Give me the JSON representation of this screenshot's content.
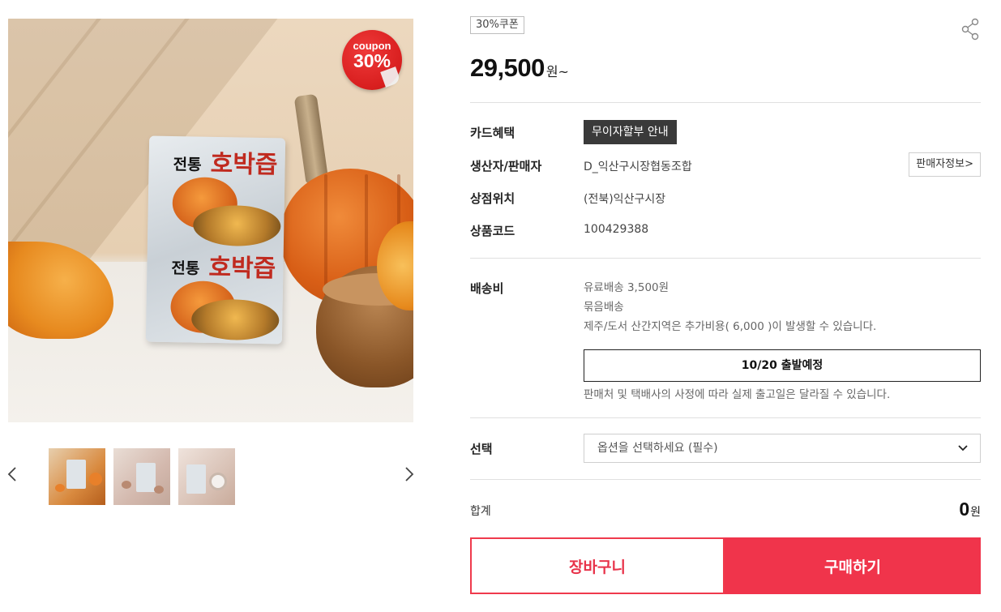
{
  "gallery": {
    "badge": {
      "word": "coupon",
      "value": "30%"
    },
    "pouch": {
      "line1_small": "전통",
      "line1_big": "호박즙",
      "line2_small": "전통",
      "line2_big": "호박즙"
    },
    "thumbnails": [
      {
        "label": "thumbnail-1"
      },
      {
        "label": "thumbnail-2"
      },
      {
        "label": "thumbnail-3"
      }
    ]
  },
  "product": {
    "coupon_tag": "30%쿠폰",
    "price": "29,500",
    "price_unit": "원~",
    "card_benefit": {
      "label": "카드혜택",
      "button": "무이자할부 안내"
    },
    "seller": {
      "label": "생산자/판매자",
      "value": "D_익산구시장협동조합",
      "button": "판매자정보>"
    },
    "location": {
      "label": "상점위치",
      "value": "(전북)익산구시장"
    },
    "code": {
      "label": "상품코드",
      "value": "100429388"
    },
    "shipping": {
      "label": "배송비",
      "lines": [
        "유료배송 3,500원",
        "묶음배송",
        "제주/도서 산간지역은 추가비용( 6,000 )이 발생할 수 있습니다."
      ],
      "depart": "10/20 출발예정",
      "notice": "판매처 및 택배사의 사정에 따라 실제 출고일은 달라질 수 있습니다."
    },
    "option": {
      "label": "선택",
      "placeholder": "옵션을 선택하세요 (필수)"
    },
    "total": {
      "label": "합계",
      "value": "0",
      "unit": "원"
    },
    "actions": {
      "cart": "장바구니",
      "buy": "구매하기"
    }
  },
  "colors": {
    "accent": "#f0344b",
    "dark_button": "#3a3a3a",
    "badge_red": "#d81e1e"
  }
}
